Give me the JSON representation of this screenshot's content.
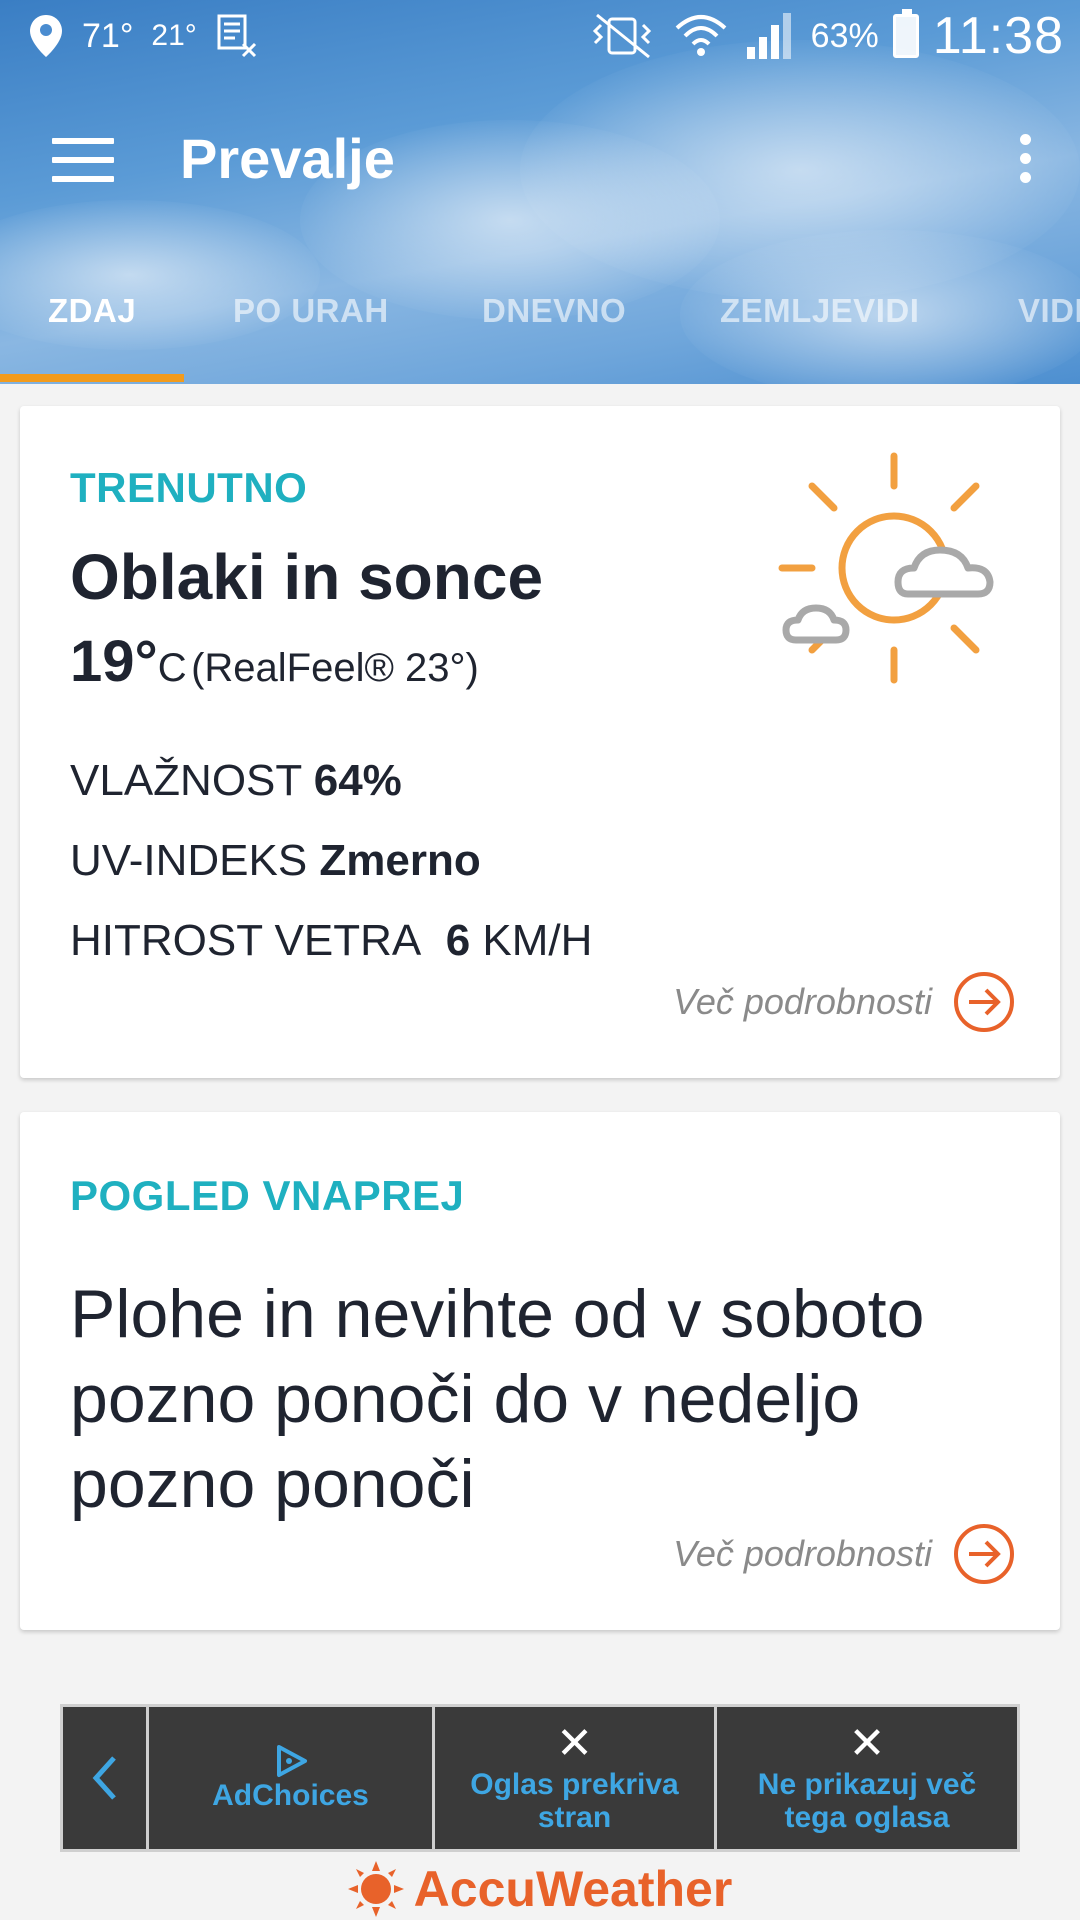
{
  "status_bar": {
    "location_icon": "location-pin-icon",
    "temp_f": "71°",
    "temp_c": "21°",
    "battery": "63%",
    "time": "11:38"
  },
  "toolbar": {
    "title": "Prevalje"
  },
  "tabs": [
    {
      "label": "ZDAJ",
      "active": true
    },
    {
      "label": "PO URAH",
      "active": false
    },
    {
      "label": "DNEVNO",
      "active": false
    },
    {
      "label": "ZEMLJEVIDI",
      "active": false
    },
    {
      "label": "VIDI",
      "active": false
    }
  ],
  "current": {
    "section_title": "TRENUTNO",
    "condition": "Oblaki in sonce",
    "temp": "19°",
    "unit": "C",
    "realfeel": "(RealFeel® 23°)",
    "humidity_label": "VLAŽNOST",
    "humidity_value": "64%",
    "uv_label": "UV-INDEKS",
    "uv_value": "Zmerno",
    "wind_label": "HITROST VETRA",
    "wind_value": "6",
    "wind_unit": "KM/H",
    "more_label": "Več podrobnosti"
  },
  "outlook": {
    "section_title": "POGLED VNAPREJ",
    "text": "Plohe in nevihte od v soboto pozno ponoči do v nedeljo pozno ponoči",
    "more_label": "Več podrobnosti"
  },
  "ad_bar": {
    "adchoices_label": "AdChoices",
    "covers_label_1": "Oglas prekriva",
    "covers_label_2": "stran",
    "hide_label_1": "Ne prikazuj več",
    "hide_label_2": "tega oglasa"
  },
  "brand": {
    "name": "AccuWeather"
  },
  "colors": {
    "accent_teal": "#1fb0c0",
    "accent_orange": "#e8622a",
    "tab_indicator": "#f29b1d",
    "ad_link": "#3ea6e3"
  }
}
